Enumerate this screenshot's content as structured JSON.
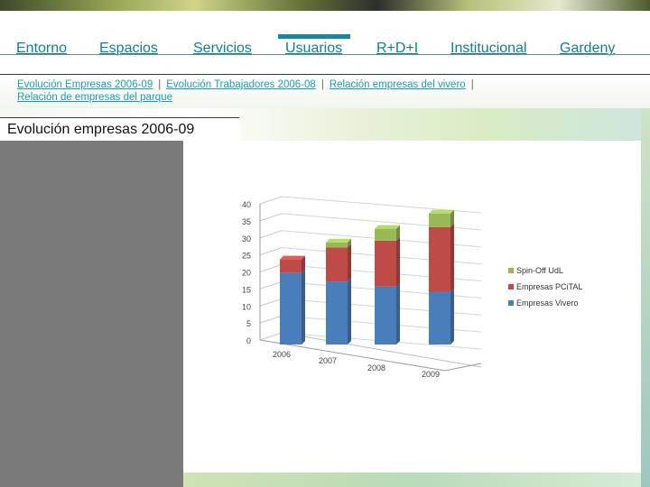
{
  "nav": {
    "items": [
      {
        "label": "Entorno"
      },
      {
        "label": "Espacios"
      },
      {
        "label": "Servicios"
      },
      {
        "label": "Usuarios"
      },
      {
        "label": "R+D+I"
      },
      {
        "label": "Institucional"
      },
      {
        "label": "Gardeny"
      }
    ],
    "active": "Usuarios"
  },
  "subnav": {
    "links": [
      "Evolución Empresas 2006-09",
      "Evolución Trabajadores 2006-08",
      "Relación empresas del vivero",
      "Relación de empresas del parque"
    ],
    "separator": "|"
  },
  "page": {
    "title": "Evolución empresas 2006-09"
  },
  "chart_data": {
    "type": "bar",
    "stacked": true,
    "categories": [
      "2006",
      "2007",
      "2008",
      "2009"
    ],
    "series": [
      {
        "name": "Empresas Vivero",
        "values": [
          21,
          18.5,
          17,
          15.5
        ],
        "color": "#4a7ebb"
      },
      {
        "name": "Empresas PCiTAL",
        "values": [
          4,
          10,
          13.5,
          19
        ],
        "color": "#be4b48"
      },
      {
        "name": "Spin-Off UdL",
        "values": [
          0,
          1.5,
          3.5,
          4
        ],
        "color": "#98b954"
      }
    ],
    "yticks": [
      0,
      5,
      10,
      15,
      20,
      25,
      30,
      35,
      40
    ],
    "ylim": [
      0,
      40
    ],
    "legend_position": "right",
    "grid": true
  }
}
